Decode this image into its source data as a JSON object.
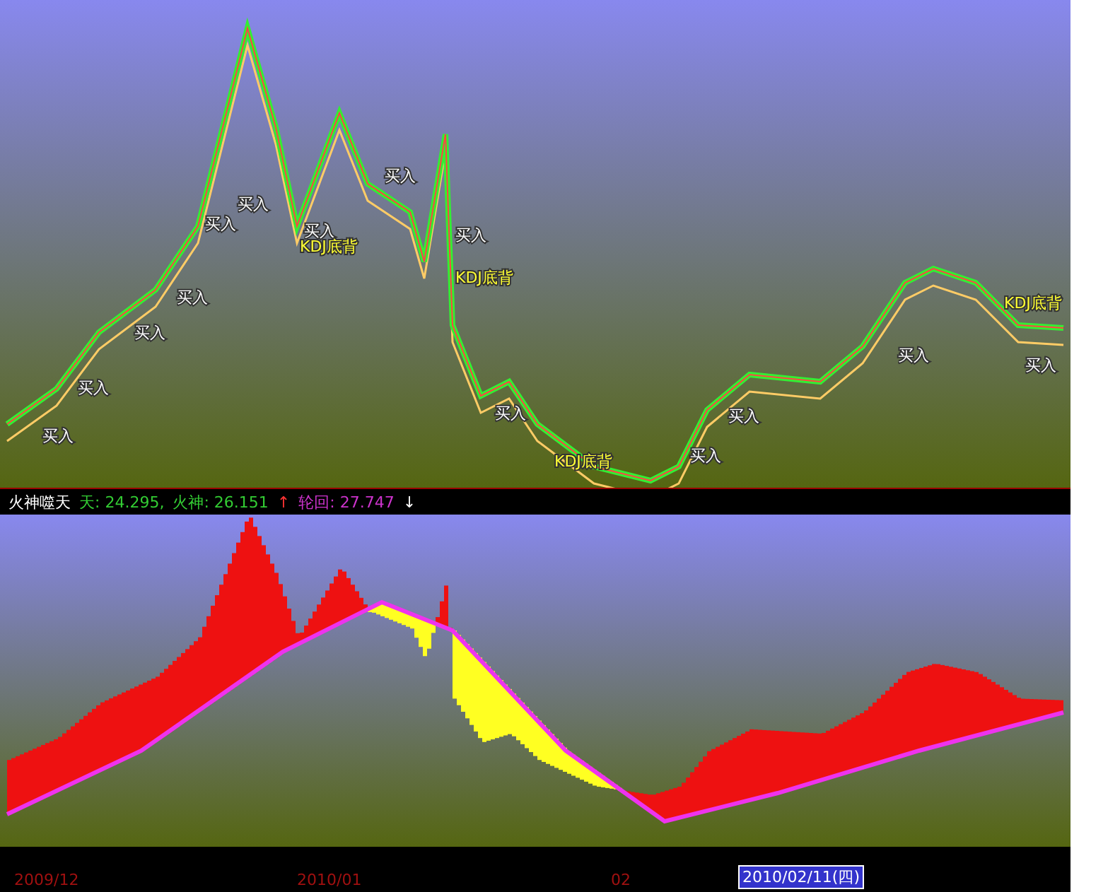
{
  "price_chart": {
    "signals": [
      {
        "text": "买入",
        "kind": "buy"
      },
      {
        "text": "买入",
        "kind": "buy"
      },
      {
        "text": "买入",
        "kind": "buy"
      },
      {
        "text": "买入",
        "kind": "buy"
      },
      {
        "text": "买入",
        "kind": "buy"
      },
      {
        "text": "买入",
        "kind": "buy"
      },
      {
        "text": "买入",
        "kind": "buy"
      },
      {
        "text": "买入",
        "kind": "buy"
      },
      {
        "text": "买入",
        "kind": "buy"
      },
      {
        "text": "买入",
        "kind": "buy"
      },
      {
        "text": "买入",
        "kind": "buy"
      },
      {
        "text": "买入",
        "kind": "buy"
      },
      {
        "text": "买入",
        "kind": "buy"
      },
      {
        "text": "买入",
        "kind": "buy"
      },
      {
        "text": "KDJ底背",
        "kind": "divergence"
      },
      {
        "text": "KDJ底背",
        "kind": "divergence"
      },
      {
        "text": "KDJ底背",
        "kind": "divergence"
      },
      {
        "text": "KDJ底背",
        "kind": "divergence"
      }
    ]
  },
  "indicator_legend": {
    "title": "火神噬天",
    "items": [
      {
        "text": "天: 24.295,",
        "color": "#33cc33"
      },
      {
        "text": "火神: 26.151",
        "color": "#33cc33"
      },
      {
        "text": "↑",
        "color": "#ff3333"
      },
      {
        "text": "轮回: 27.747",
        "color": "#cc33cc"
      },
      {
        "text": "↓",
        "color": "#ffffff"
      }
    ]
  },
  "time_axis": [
    {
      "text": "2009/12",
      "selected": false
    },
    {
      "text": "2010/01",
      "selected": false
    },
    {
      "text": "02",
      "selected": false
    },
    {
      "text": "2010/02/11(四)",
      "selected": true
    }
  ]
}
